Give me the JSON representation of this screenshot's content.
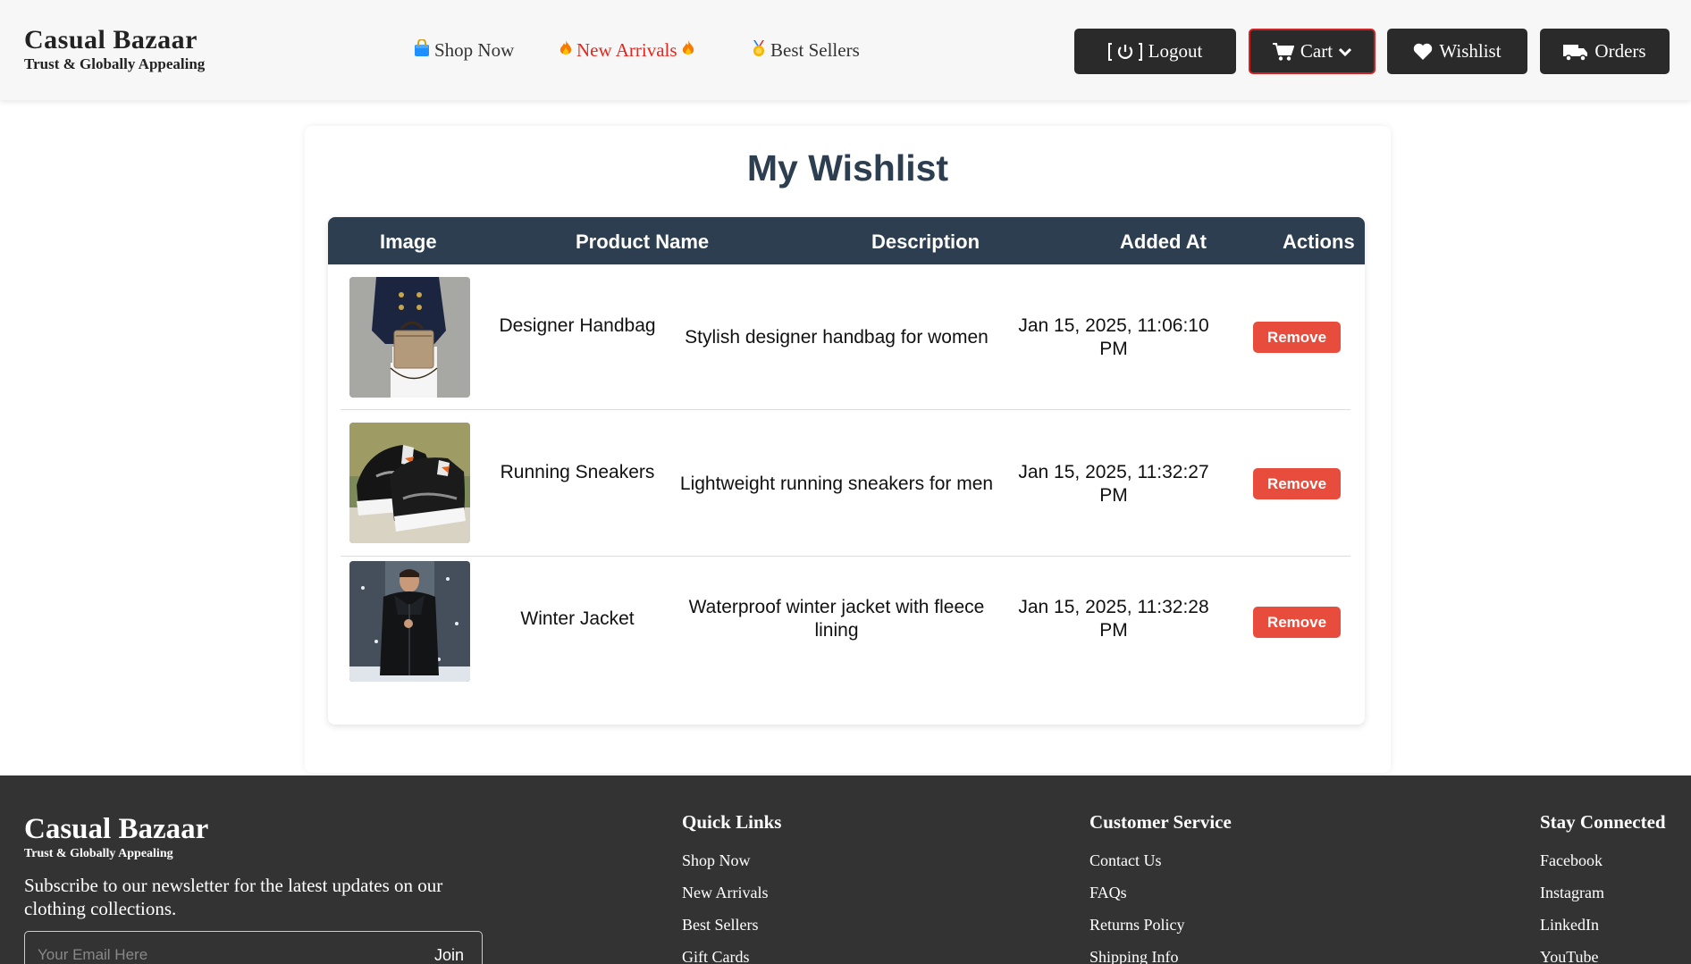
{
  "header": {
    "brand_name": "Casual Bazaar",
    "brand_tagline": "Trust & Globally Appealing",
    "nav": {
      "shop_now": "Shop Now",
      "new_arrivals": "New Arrivals",
      "best_sellers": "Best Sellers"
    },
    "buttons": {
      "logout": "Logout",
      "cart": "Cart",
      "wishlist": "Wishlist",
      "orders": "Orders"
    }
  },
  "main": {
    "title": "My Wishlist",
    "columns": [
      "Image",
      "Product Name",
      "Description",
      "Added At",
      "Actions"
    ],
    "items": [
      {
        "name": "Designer Handbag",
        "description": "Stylish designer handbag for women",
        "added_at": "Jan 15, 2025, 11:06:10 PM",
        "action": "Remove"
      },
      {
        "name": "Running Sneakers",
        "description": "Lightweight running sneakers for men",
        "added_at": "Jan 15, 2025, 11:32:27 PM",
        "action": "Remove"
      },
      {
        "name": "Winter Jacket",
        "description": "Waterproof winter jacket with fleece lining",
        "added_at": "Jan 15, 2025, 11:32:28 PM",
        "action": "Remove"
      }
    ]
  },
  "footer": {
    "brand_name": "Casual Bazaar",
    "brand_tagline": "Trust & Globally Appealing",
    "subscribe_text": "Subscribe to our newsletter for the latest updates on our clothing collections.",
    "email_placeholder": "Your Email Here",
    "join_label": "Join",
    "quick_links": {
      "heading": "Quick Links",
      "links": [
        "Shop Now",
        "New Arrivals",
        "Best Sellers",
        "Gift Cards"
      ]
    },
    "customer_service": {
      "heading": "Customer Service",
      "links": [
        "Contact Us",
        "FAQs",
        "Returns Policy",
        "Shipping Info"
      ]
    },
    "stay_connected": {
      "heading": "Stay Connected",
      "links": [
        "Facebook",
        "Instagram",
        "LinkedIn",
        "YouTube"
      ]
    }
  },
  "colors": {
    "header_bg": "#f7f7f7",
    "button_dark": "#2a2a2a",
    "cart_border": "#d32020",
    "new_arrivals_red": "#e8251c",
    "table_header": "#2c3e50",
    "remove_red": "#e74c3c",
    "footer_bg": "#333333"
  },
  "icons": {
    "shop_now": "shopping-bag-icon",
    "new_arrivals": "fire-icon",
    "best_sellers": "medal-icon",
    "logout": "power-icon",
    "cart": "cart-icon",
    "cart_dropdown": "chevron-down-icon",
    "wishlist": "heart-icon",
    "orders": "truck-icon"
  }
}
